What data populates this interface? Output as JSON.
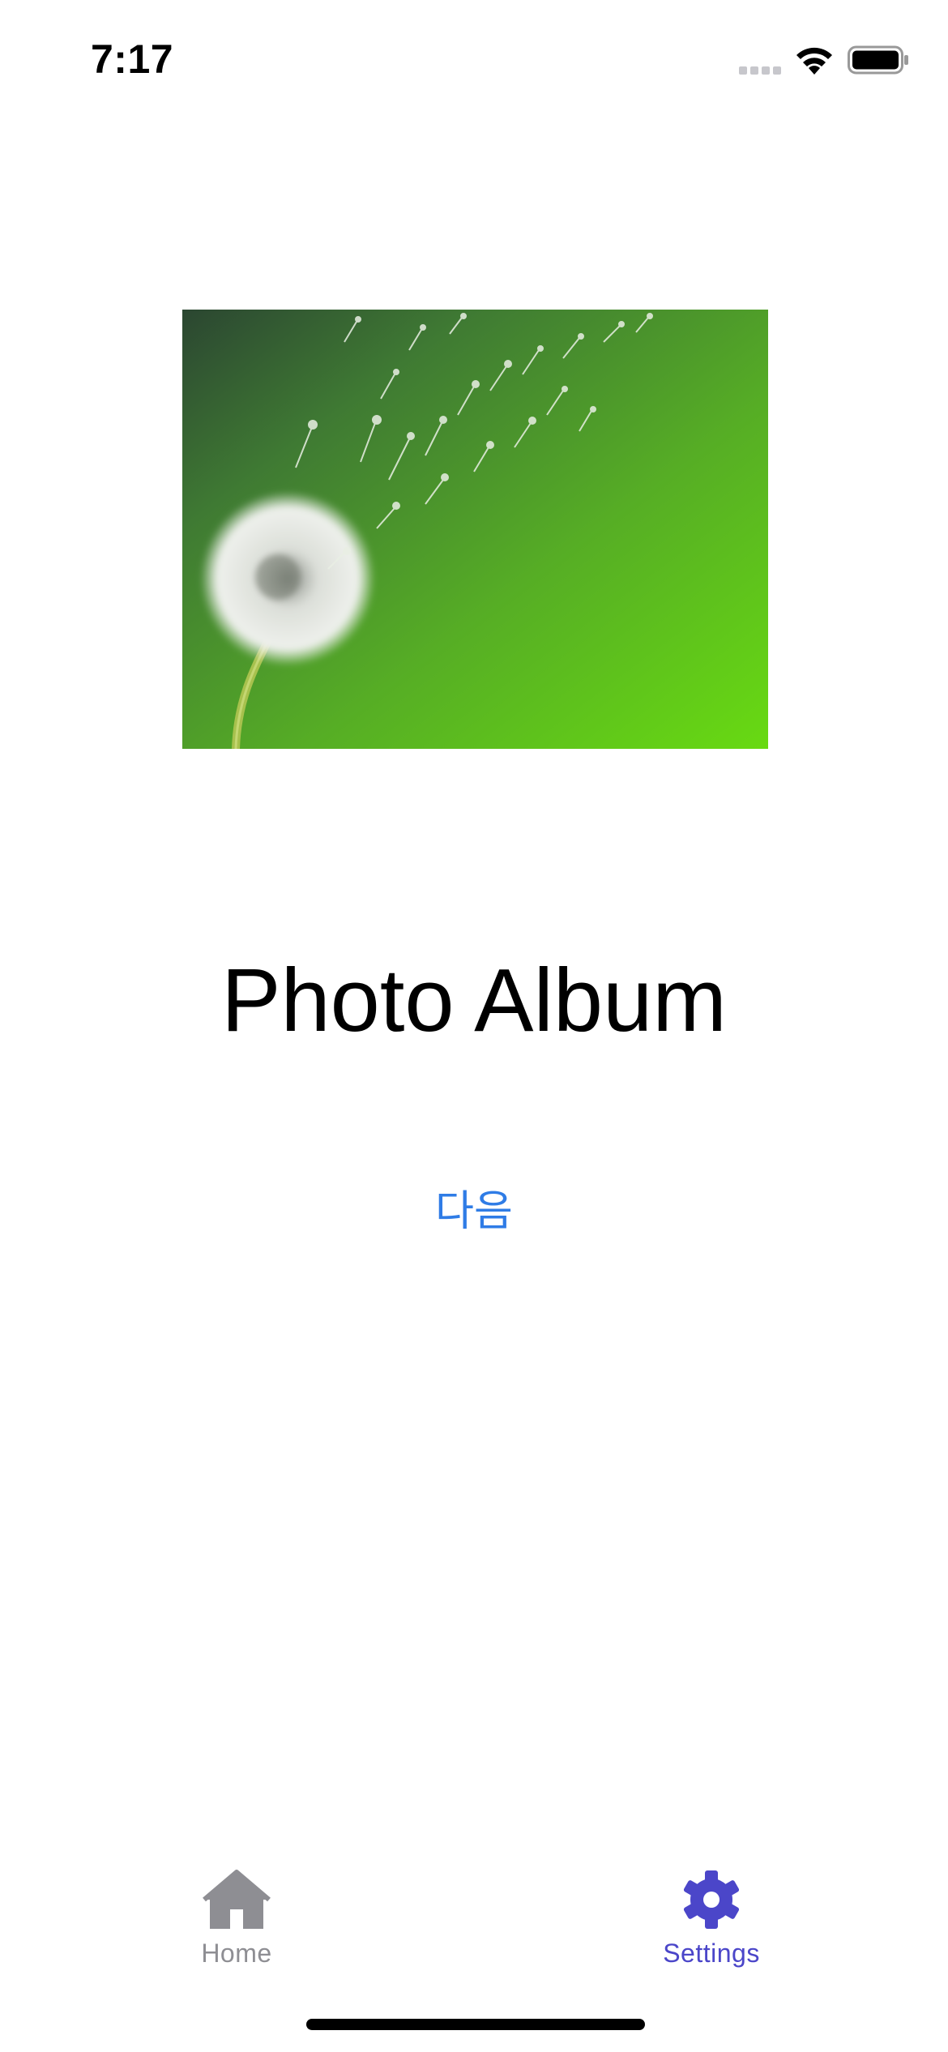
{
  "status_bar": {
    "time": "7:17",
    "signal_icon": "cellular-signal-icon",
    "wifi_icon": "wifi-icon",
    "battery_icon": "battery-icon"
  },
  "main": {
    "image_description_icon": "dandelion-photo",
    "title": "Photo Album",
    "next_button_label": "다음"
  },
  "tab_bar": {
    "items": [
      {
        "label": "Home",
        "icon": "house-icon",
        "selected": false
      },
      {
        "label": "Settings",
        "icon": "gear-icon",
        "selected": true
      }
    ]
  },
  "colors": {
    "accent_blue": "#2f7ce6",
    "tab_selected": "#4b46c9",
    "tab_unselected": "#8e8e93",
    "photo_green_light": "#66d614",
    "photo_green_dark": "#2d4a30"
  }
}
